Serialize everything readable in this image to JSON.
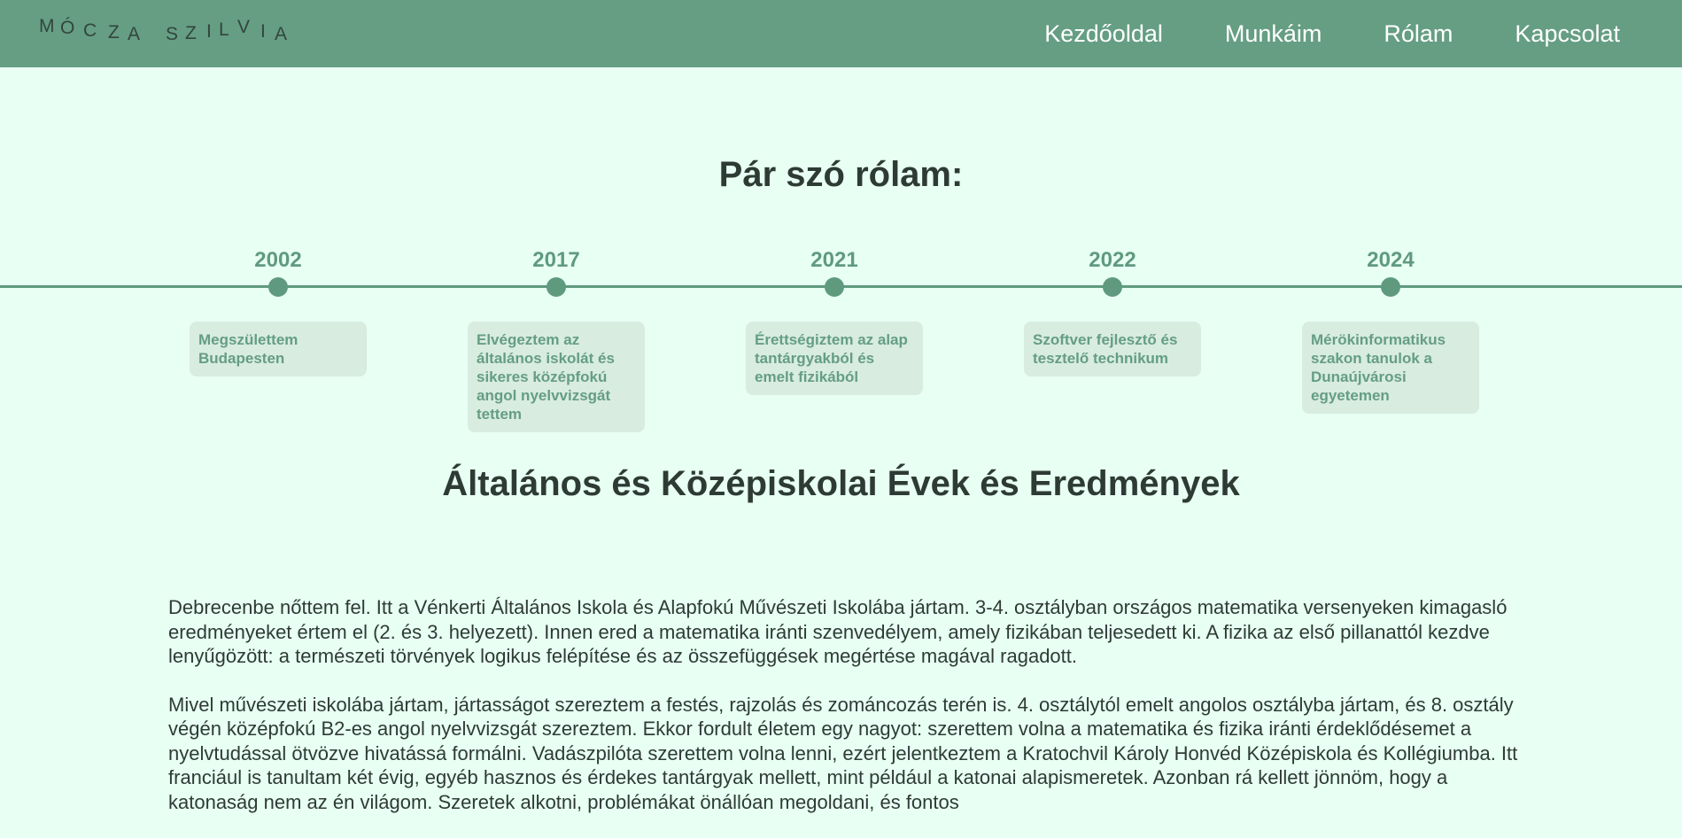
{
  "header": {
    "logo_letters": [
      "M",
      "Ó",
      "C",
      "Z",
      "A",
      "S",
      "Z",
      "I",
      "L",
      "V",
      "I",
      "A"
    ],
    "nav": [
      "Kezdőoldal",
      "Munkáim",
      "Rólam",
      "Kapcsolat"
    ]
  },
  "page_title": "Pár szó rólam:",
  "timeline": [
    {
      "year": "2002",
      "text": "Megszülettem Budapesten"
    },
    {
      "year": "2017",
      "text": "Elvégeztem az általános iskolát és sikeres középfokú angol nyelvvizsgát tettem"
    },
    {
      "year": "2021",
      "text": "Érettségiztem az alap tantárgyakból és emelt fizikából"
    },
    {
      "year": "2022",
      "text": "Szoftver fejlesztő és tesztelő technikum"
    },
    {
      "year": "2024",
      "text": "Mérökinformatikus szakon tanulok a Dunaújvárosi egyetemen"
    }
  ],
  "section_title": "Általános és Középiskolai Évek és Eredmények",
  "paragraphs": [
    "Debrecenbe nőttem fel. Itt a Vénkerti Általános Iskola és Alapfokú Művészeti Iskolába jártam. 3-4. osztályban országos matematika versenyeken kimagasló eredményeket értem el (2. és 3. helyezett). Innen ered a matematika iránti szenvedélyem, amely fizikában teljesedett ki. A fizika az első pillanattól kezdve lenyűgözött: a természeti törvények logikus felépítése és az összefüggések megértése magával ragadott.",
    "Mivel művészeti iskolába jártam, jártasságot szereztem a festés, rajzolás és zománcozás terén is. 4. osztálytól emelt angolos osztályba jártam, és 8. osztály végén középfokú B2-es angol nyelvvizsgát szereztem. Ekkor fordult életem egy nagyot: szerettem volna a matematika és fizika iránti érdeklődésemet a nyelvtudással ötvözve hivatássá formálni. Vadászpilóta szerettem volna lenni, ezért jelentkeztem a Kratochvil Károly Honvéd Középiskola és Kollégiumba. Itt franciául is tanultam két évig, egyéb hasznos és érdekes tantárgyak mellett, mint például a katonai alapismeretek. Azonban rá kellett jönnöm, hogy a katonaság nem az én világom. Szeretek alkotni, problémákat önállóan megoldani, és fontos"
  ]
}
